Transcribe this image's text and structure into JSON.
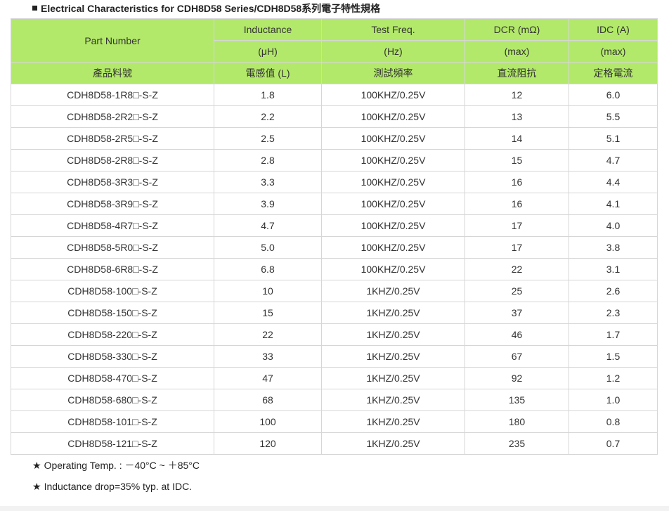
{
  "heading": {
    "text": "Electrical Characteristics for CDH8D58 Series/CDH8D58系列電子特性規格"
  },
  "table": {
    "header_row1": [
      "Part Number",
      "Inductance",
      "Test Freq.",
      "DCR (mΩ)",
      "IDC (A)"
    ],
    "header_row2": [
      "(μH)",
      "(Hz)",
      "(max)",
      "(max)"
    ],
    "header_row3": [
      "產品料號",
      "電感值 (L)",
      "測試頻率",
      "直流阻抗",
      "定格電流"
    ],
    "rows": [
      [
        "CDH8D58-1R8□-S-Z",
        "1.8",
        "100KHZ/0.25V",
        "12",
        "6.0"
      ],
      [
        "CDH8D58-2R2□-S-Z",
        "2.2",
        "100KHZ/0.25V",
        "13",
        "5.5"
      ],
      [
        "CDH8D58-2R5□-S-Z",
        "2.5",
        "100KHZ/0.25V",
        "14",
        "5.1"
      ],
      [
        "CDH8D58-2R8□-S-Z",
        "2.8",
        "100KHZ/0.25V",
        "15",
        "4.7"
      ],
      [
        "CDH8D58-3R3□-S-Z",
        "3.3",
        "100KHZ/0.25V",
        "16",
        "4.4"
      ],
      [
        "CDH8D58-3R9□-S-Z",
        "3.9",
        "100KHZ/0.25V",
        "16",
        "4.1"
      ],
      [
        "CDH8D58-4R7□-S-Z",
        "4.7",
        "100KHZ/0.25V",
        "17",
        "4.0"
      ],
      [
        "CDH8D58-5R0□-S-Z",
        "5.0",
        "100KHZ/0.25V",
        "17",
        "3.8"
      ],
      [
        "CDH8D58-6R8□-S-Z",
        "6.8",
        "100KHZ/0.25V",
        "22",
        "3.1"
      ],
      [
        "CDH8D58-100□-S-Z",
        "10",
        "1KHZ/0.25V",
        "25",
        "2.6"
      ],
      [
        "CDH8D58-150□-S-Z",
        "15",
        "1KHZ/0.25V",
        "37",
        "2.3"
      ],
      [
        "CDH8D58-220□-S-Z",
        "22",
        "1KHZ/0.25V",
        "46",
        "1.7"
      ],
      [
        "CDH8D58-330□-S-Z",
        "33",
        "1KHZ/0.25V",
        "67",
        "1.5"
      ],
      [
        "CDH8D58-470□-S-Z",
        "47",
        "1KHZ/0.25V",
        "92",
        "1.2"
      ],
      [
        "CDH8D58-680□-S-Z",
        "68",
        "1KHZ/0.25V",
        "135",
        "1.0"
      ],
      [
        "CDH8D58-101□-S-Z",
        "100",
        "1KHZ/0.25V",
        "180",
        "0.8"
      ],
      [
        "CDH8D58-121□-S-Z",
        "120",
        "1KHZ/0.25V",
        "235",
        "0.7"
      ]
    ]
  },
  "notes": [
    {
      "symbol": "★",
      "text": "Operating Temp. : －40°C ~ ＋85°C"
    },
    {
      "symbol": "★",
      "text": "Inductance drop=35% typ. at IDC."
    }
  ],
  "colors": {
    "header_bg": "#b3e96a",
    "border": "#d6d6d6",
    "text": "#333333"
  }
}
